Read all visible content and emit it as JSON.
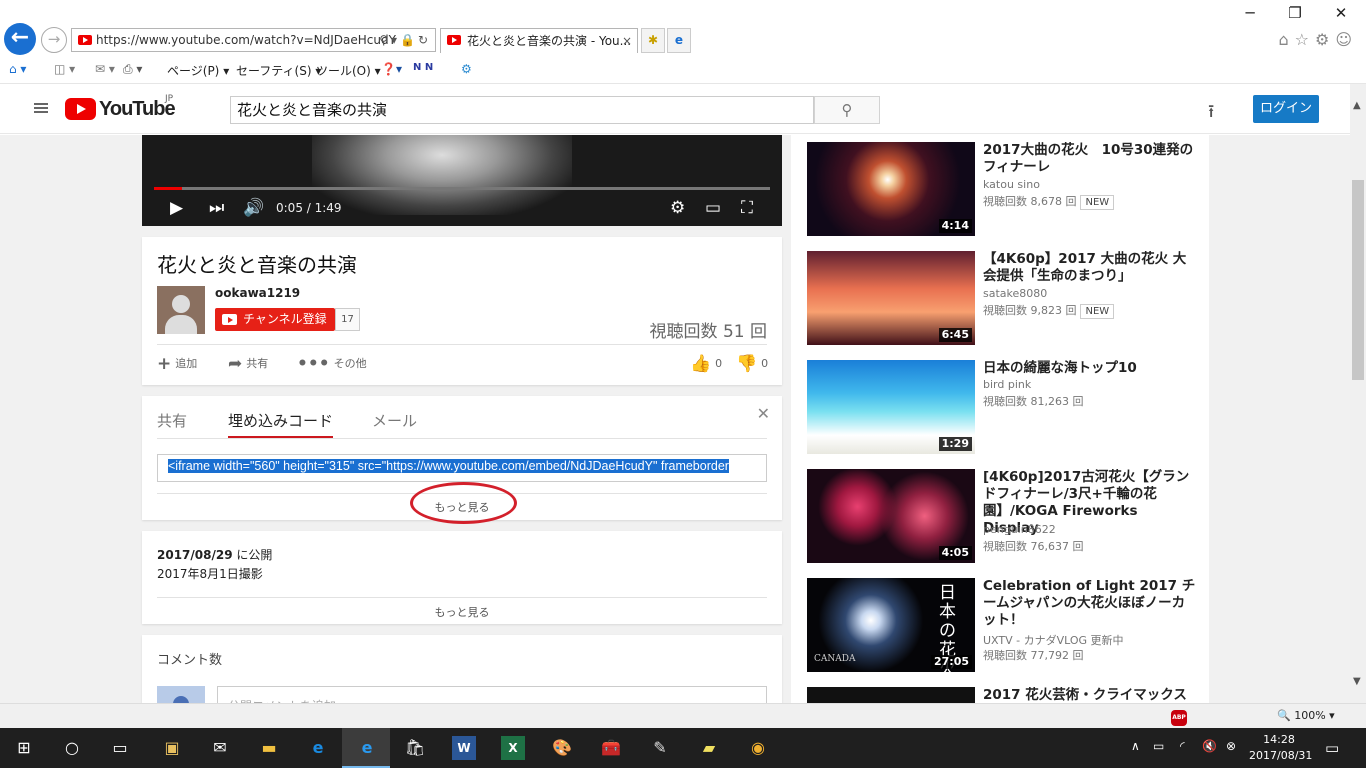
{
  "browser": {
    "url": "https://www.youtube.com/watch?v=NdJDaeHcudY",
    "tab_title": "花火と炎と音楽の共演 - You...",
    "tab_close": "×",
    "menu": {
      "page": "ページ(P)",
      "safety": "セーフティ(S)",
      "tools": "ツール(O)"
    },
    "window_controls": [
      "─",
      "❐",
      "✕"
    ],
    "zoom": "100%"
  },
  "youtube": {
    "logo_text": "YouTube",
    "region": "JP",
    "search_value": "花火と炎と音楽の共演",
    "login_label": "ログイン"
  },
  "video": {
    "time": "0:05 / 1:49",
    "progress_fraction": 0.045,
    "title": "花火と炎と音楽の共演",
    "uploader": "ookawa1219",
    "subscribe_label": "チャンネル登録",
    "subscriber_count": "17",
    "views": "視聴回数 51 回",
    "actions": {
      "add": "追加",
      "share": "共有",
      "more": "その他",
      "likes": "0",
      "dislikes": "0"
    }
  },
  "share_panel": {
    "tabs": [
      "共有",
      "埋め込みコード",
      "メール"
    ],
    "active_tab": "埋め込みコード",
    "embed_code": "<iframe width=\"560\" height=\"315\" src=\"https://www.youtube.com/embed/NdJDaeHcudY\" frameborder",
    "show_more": "もっと見る"
  },
  "description": {
    "published_date": "2017/08/29",
    "published_suffix": " に公開",
    "shot_date": "2017年8月1日撮影",
    "show_more": "もっと見る"
  },
  "comments": {
    "title": "コメント数",
    "placeholder": "公開コメントを追加..."
  },
  "related": [
    {
      "title": "2017大曲の花火　10号30連発のフィナーレ",
      "channel": "katou sino",
      "views": "視聴回数 8,678 回",
      "badge": "NEW",
      "duration": "4:14",
      "thumb_color": "#1a0a14"
    },
    {
      "title": "【4K60p】2017 大曲の花火 大会提供「生命のまつり」",
      "channel": "satake8080",
      "views": "視聴回数 9,823 回",
      "badge": "NEW",
      "duration": "6:45",
      "thumb_color": "#c84a2a"
    },
    {
      "title": "日本の綺麗な海トップ10",
      "channel": "bird pink",
      "views": "視聴回数 81,263 回",
      "badge": "",
      "duration": "1:29",
      "thumb_color": "#1fb3e0"
    },
    {
      "title": "[4K60p]2017古河花火【グランドフィナーレ/3尺+千輪の花園】/KOGA Fireworks Display",
      "channel": "penguin8622",
      "views": "視聴回数 76,637 回",
      "badge": "",
      "duration": "4:05",
      "thumb_color": "#2a0a18"
    },
    {
      "title": "Celebration of Light 2017 チームジャパンの大花火ほぼノーカット！",
      "channel": "UXTV - カナダVLOG 更新中",
      "views": "視聴回数 77,792 回",
      "badge": "",
      "duration": "27:05",
      "thumb_color": "#0a0a0a",
      "thumb_text": "日本の花火",
      "thumb_sub": "CANADA"
    },
    {
      "title": "2017 花火芸術・クライマックス",
      "channel": "",
      "views": "",
      "badge": "",
      "duration": "",
      "thumb_color": "#111"
    }
  ],
  "taskbar": {
    "time": "14:28",
    "date": "2017/08/31"
  }
}
